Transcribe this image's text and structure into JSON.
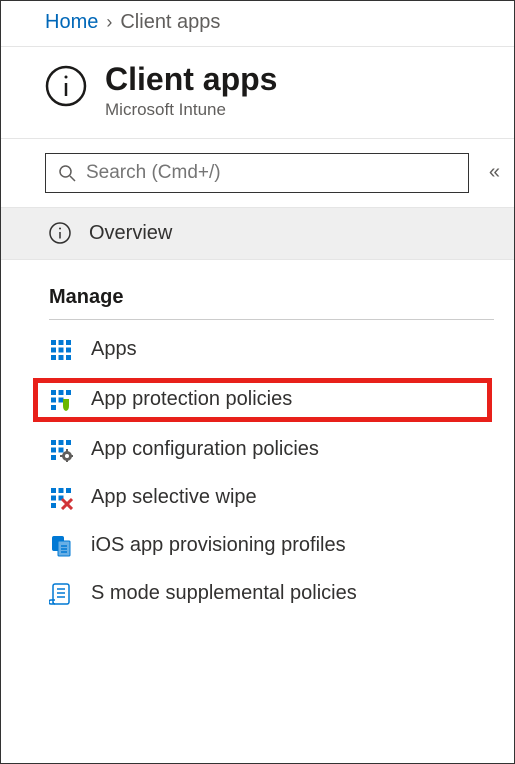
{
  "breadcrumb": {
    "home": "Home",
    "current": "Client apps"
  },
  "header": {
    "title": "Client apps",
    "subtitle": "Microsoft Intune"
  },
  "search": {
    "placeholder": "Search (Cmd+/)"
  },
  "overview": {
    "label": "Overview"
  },
  "section": {
    "manage": "Manage"
  },
  "menu": {
    "apps": "Apps",
    "app_protection": "App protection policies",
    "app_configuration": "App configuration policies",
    "app_selective_wipe": "App selective wipe",
    "ios_provisioning": "iOS app provisioning profiles",
    "s_mode": "S mode supplemental policies"
  }
}
